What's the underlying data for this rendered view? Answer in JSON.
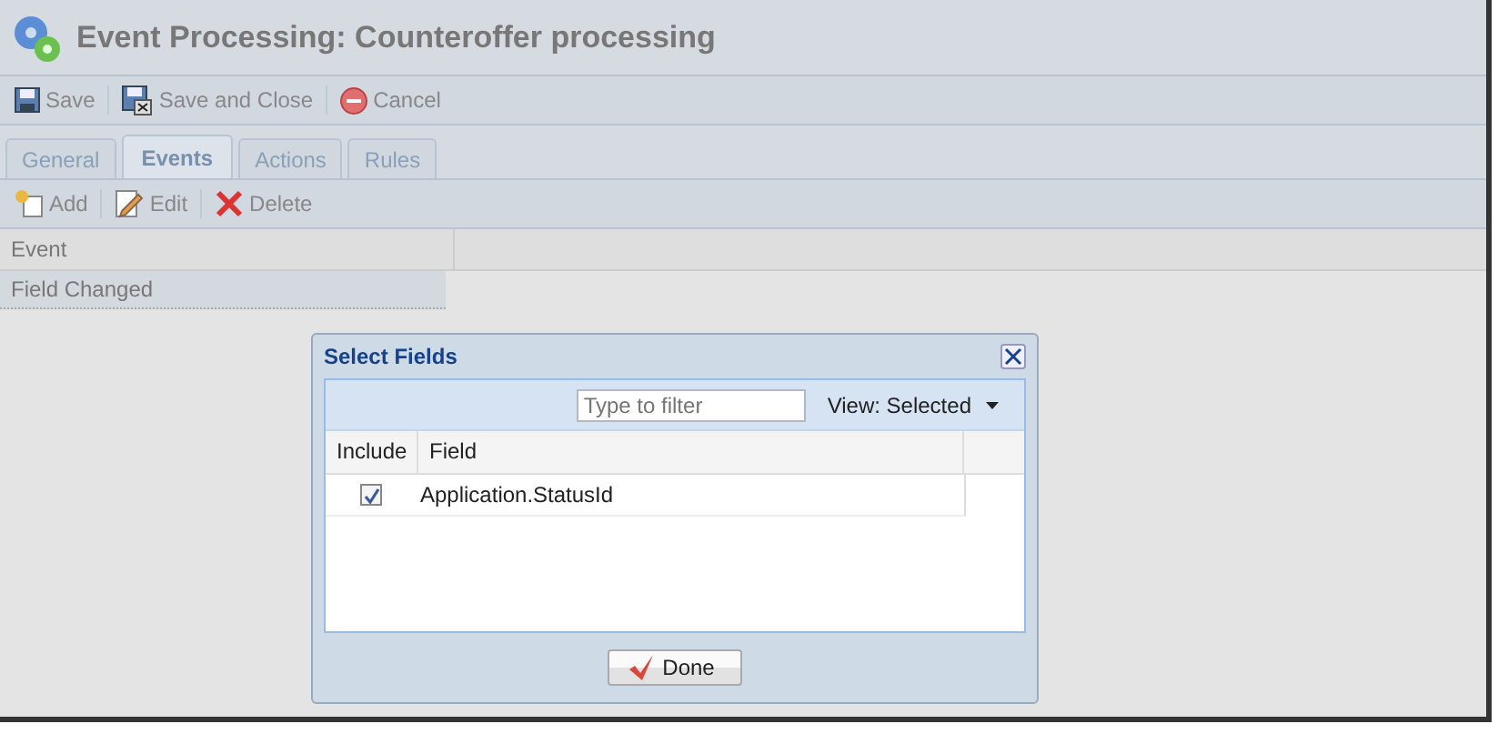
{
  "window": {
    "title": "Event Processing: Counteroffer processing"
  },
  "toolbar": [
    {
      "kind": "save",
      "label": "Save"
    },
    {
      "kind": "save-close",
      "label": "Save and Close"
    },
    {
      "kind": "cancel",
      "label": "Cancel"
    }
  ],
  "tabs": [
    {
      "label": "General",
      "selected": false
    },
    {
      "label": "Events",
      "selected": true
    },
    {
      "label": "Actions",
      "selected": false
    },
    {
      "label": "Rules",
      "selected": false
    }
  ],
  "tab_toolbar": [
    {
      "kind": "add",
      "label": "Add"
    },
    {
      "kind": "edit",
      "label": "Edit"
    },
    {
      "kind": "delete",
      "label": "Delete"
    }
  ],
  "table": {
    "columns": [
      "Event"
    ],
    "rows": [
      [
        "Field Changed"
      ]
    ]
  },
  "dialog": {
    "title": "Select Fields",
    "filter": {
      "placeholder": "Type to filter"
    },
    "view": "View: Selected",
    "columns": [
      "Include",
      "Field"
    ],
    "rows": [
      {
        "checked": true,
        "field": "Application.StatusId"
      }
    ],
    "button": "Done"
  }
}
